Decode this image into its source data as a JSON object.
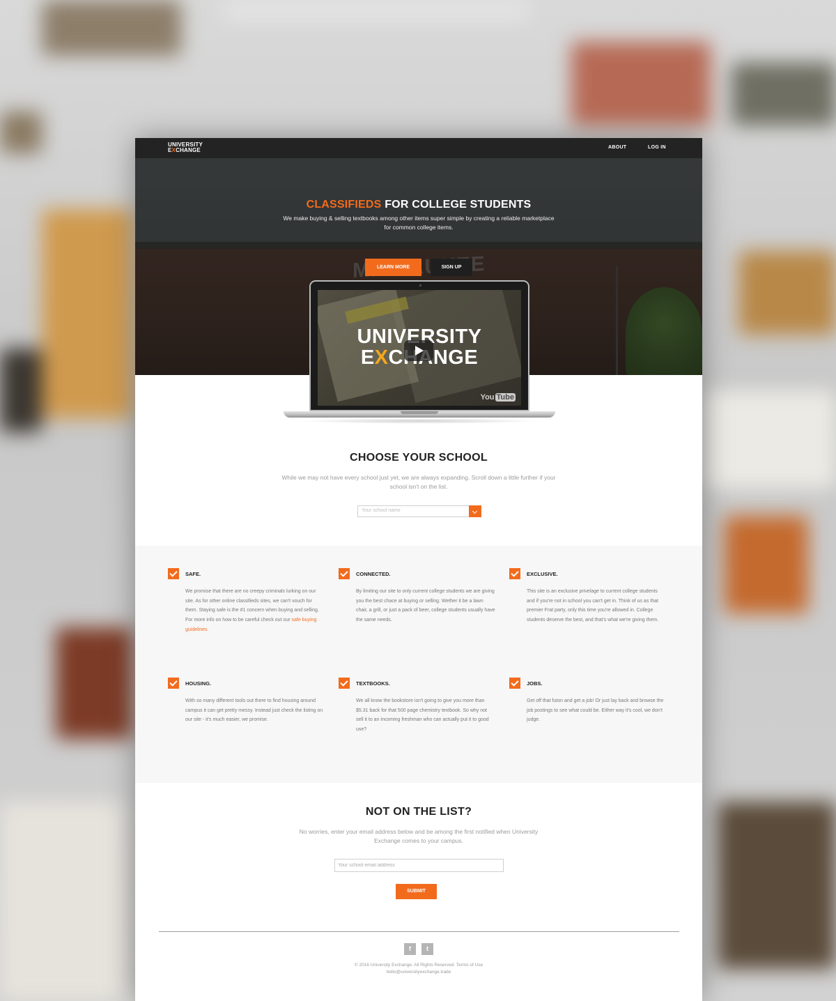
{
  "brand": {
    "logo_line1": "UNIVERSITY",
    "logo_line2_x": "E",
    "logo_line2_mark": "X",
    "logo_line2_rest": "CHANGE",
    "accent_color": "#f26b1d"
  },
  "nav": {
    "about": "ABOUT",
    "login": "LOG IN"
  },
  "hero": {
    "title_accent": "CLASSIFIEDS",
    "title_rest": " FOR COLLEGE STUDENTS",
    "subtitle": "We make buying & selling textbooks among other items super simple by creating a reliable marketplace for common college items.",
    "learn_more": "LEARN MORE",
    "sign_up": "SIGN UP",
    "building_sign": "MILWAUKEE"
  },
  "video": {
    "logo_line1": "UNIVERSITY",
    "logo_line2_e": "E",
    "logo_line2_x": "X",
    "logo_line2_rest": "CHANGE",
    "yt_you": "You",
    "yt_tube": "Tube",
    "play_icon": "play-icon"
  },
  "school": {
    "title": "CHOOSE YOUR SCHOOL",
    "subtitle": "While we may not have every school just yet, we are always expanding. Scroll down a little further if your school isn't on the list.",
    "select_placeholder": "Your school name"
  },
  "features": [
    {
      "title": "SAFE.",
      "desc": "We promise that there are no creepy criminals lurking on our site. As for other online classifieds sites, we can't vouch for them. Staying safe is the #1 concern when buying and selling. For more info on how to be careful check out our ",
      "link": "safe buying guidelines."
    },
    {
      "title": "CONNECTED.",
      "desc": "By limiting our site to only current college students we are giving you the best chace at buying or selling. Wether it be a lawn chair, a grill, or just a pack of beer, college students usually have the same needs."
    },
    {
      "title": "EXCLUSIVE.",
      "desc": "This site is an exclusive privelage to current college students and if you're not in school you can't get in. Think of us as that premier Frat party, only this time you're allowed in. College students deserve the best, and that's what we're giving them."
    },
    {
      "title": "HOUSING.",
      "desc": "With so many different tools out there to find housing around campus it can get pretty messy. Instead just check the listing on our site - it's much easier, we promise."
    },
    {
      "title": "TEXTBOOKS.",
      "desc": "We all know the bookstore isn't going to give you more than $5.31 back for that 500 page chemistry textbook. So why not sell it to an incoming freshman who can actually put it to good use?"
    },
    {
      "title": "JOBS.",
      "desc": "Get off that futon and get a job! Or just lay back and browse the job postings to see what could be. Either way it's cool, we don't judge."
    }
  ],
  "notlist": {
    "title": "NOT ON THE LIST?",
    "subtitle": "No worries, enter your email address below and be among the first notified when University Exchange comes to your campus.",
    "email_placeholder": "Your school email address",
    "submit": "SUBMIT"
  },
  "footer": {
    "facebook": "f",
    "twitter": "t",
    "copyright": "© 2016 University Exchange. All Rights Reserved. Terms of Use",
    "email": "hello@universityexchange.trade"
  }
}
